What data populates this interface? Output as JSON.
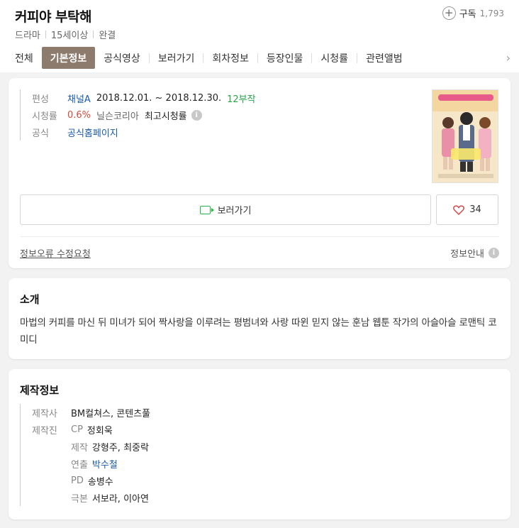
{
  "header": {
    "title": "커피야 부탁해",
    "meta": [
      "드라마",
      "15세이상",
      "완결"
    ],
    "subscribe": {
      "label": "구독",
      "count": "1,793"
    }
  },
  "tabs": [
    "전체",
    "기본정보",
    "공식영상",
    "보러가기",
    "회차정보",
    "등장인물",
    "시청률",
    "관련앨범"
  ],
  "basic": {
    "broadcast": {
      "label": "편성",
      "channel": "채널A",
      "period": "2018.12.01. ~ 2018.12.30.",
      "episodes": "12부작"
    },
    "rating": {
      "label": "시청률",
      "value": "0.6%",
      "source": "닐슨코리아",
      "kind": "최고시청률"
    },
    "official": {
      "label": "공식",
      "link": "공식홈페이지"
    },
    "watch_label": "보러가기",
    "like_count": "34",
    "error_report": "정보오류 수정요청",
    "info_guide": "정보안내"
  },
  "intro": {
    "title": "소개",
    "text": "마법의 커피를 마신 뒤 미녀가 되어 짝사랑을 이루려는 평범녀와 사랑 따윈 믿지 않는 훈남 웹툰 작가의 아슬아슬 로맨틱 코미디"
  },
  "production": {
    "title": "제작정보",
    "company_label": "제작사",
    "company": "BM컬쳐스, 콘텐츠풀",
    "staff_label": "제작진",
    "staff": [
      {
        "role": "CP",
        "name": "정회욱"
      },
      {
        "role": "제작",
        "name": "강형주, 최중락"
      },
      {
        "role": "연출",
        "name": "박수철"
      },
      {
        "role": "PD",
        "name": "송병수"
      },
      {
        "role": "극본",
        "name": "서보라, 이아연"
      }
    ]
  },
  "colors": {
    "tab_active": "#8d7b6e",
    "link": "#1a5ba8",
    "rating": "#d04a3a",
    "episodes": "#29a34a",
    "watch_icon": "#2bb34b",
    "heart": "#d04a4a"
  }
}
